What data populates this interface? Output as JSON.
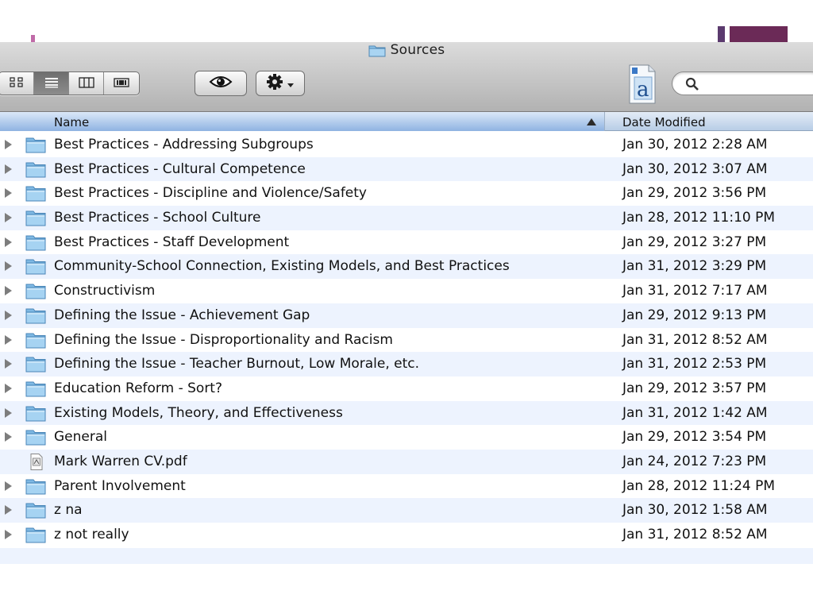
{
  "window": {
    "title": "Sources",
    "folder_icon": "folder-icon"
  },
  "toolbar": {
    "view_modes": [
      {
        "name": "icon-view",
        "icon": "grid-icon",
        "active": false
      },
      {
        "name": "list-view",
        "icon": "list-icon",
        "active": true
      },
      {
        "name": "column-view",
        "icon": "columns-icon",
        "active": false
      },
      {
        "name": "coverflow-view",
        "icon": "coverflow-icon",
        "active": false
      }
    ],
    "quicklook_icon": "eye-icon",
    "action_icon": "gear-icon",
    "app_icon": "dictionary-icon",
    "search": {
      "value": "",
      "placeholder": ""
    }
  },
  "columns": {
    "name": "Name",
    "date_modified": "Date Modified"
  },
  "files": [
    {
      "name": "Best Practices - Addressing Subgroups",
      "date": "Jan 30, 2012 2:28 AM",
      "kind": "folder"
    },
    {
      "name": "Best Practices - Cultural Competence",
      "date": "Jan 30, 2012 3:07 AM",
      "kind": "folder"
    },
    {
      "name": "Best Practices - Discipline and Violence/Safety",
      "date": "Jan 29, 2012 3:56 PM",
      "kind": "folder"
    },
    {
      "name": "Best Practices - School Culture",
      "date": "Jan 28, 2012 11:10 PM",
      "kind": "folder"
    },
    {
      "name": "Best Practices - Staff Development",
      "date": "Jan 29, 2012 3:27 PM",
      "kind": "folder"
    },
    {
      "name": "Community-School Connection, Existing Models, and Best Practices",
      "date": "Jan 31, 2012 3:29 PM",
      "kind": "folder"
    },
    {
      "name": "Constructivism",
      "date": "Jan 31, 2012 7:17 AM",
      "kind": "folder"
    },
    {
      "name": "Defining the Issue - Achievement Gap",
      "date": "Jan 29, 2012 9:13 PM",
      "kind": "folder"
    },
    {
      "name": "Defining the Issue - Disproportionality and Racism",
      "date": "Jan 31, 2012 8:52 AM",
      "kind": "folder"
    },
    {
      "name": "Defining the Issue - Teacher Burnout, Low Morale, etc.",
      "date": "Jan 31, 2012 2:53 PM",
      "kind": "folder"
    },
    {
      "name": "Education Reform - Sort?",
      "date": "Jan 29, 2012 3:57 PM",
      "kind": "folder"
    },
    {
      "name": "Existing Models, Theory, and Effectiveness",
      "date": "Jan 31, 2012 1:42 AM",
      "kind": "folder"
    },
    {
      "name": "General",
      "date": "Jan 29, 2012 3:54 PM",
      "kind": "folder"
    },
    {
      "name": "Mark Warren CV.pdf",
      "date": "Jan 24, 2012 7:23 PM",
      "kind": "pdf"
    },
    {
      "name": "Parent Involvement",
      "date": "Jan 28, 2012 11:24 PM",
      "kind": "folder"
    },
    {
      "name": "z na",
      "date": "Jan 30, 2012 1:58 AM",
      "kind": "folder"
    },
    {
      "name": "z not really",
      "date": "Jan 31, 2012 8:52 AM",
      "kind": "folder"
    }
  ],
  "colors": {
    "header_blue": "#8fb3e2",
    "alt_row": "#edf3fe",
    "folder_blue": "#8ec4ea",
    "slide_accent": "#6b2a57"
  }
}
